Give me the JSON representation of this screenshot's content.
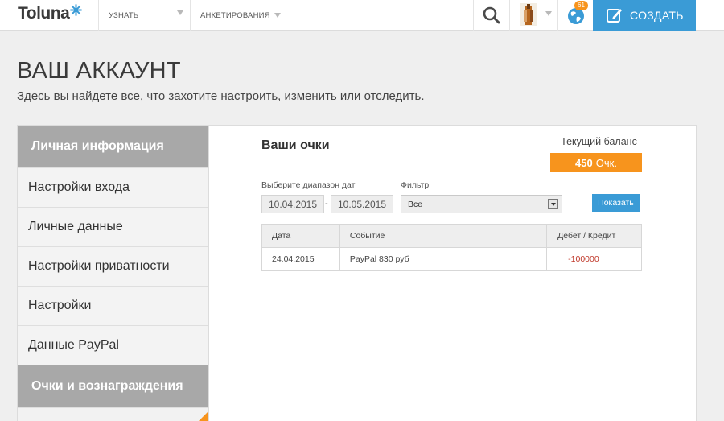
{
  "header": {
    "logo_text": "Toluna",
    "nav": [
      {
        "label": "УЗНАТЬ"
      },
      {
        "label": "АНКЕТИРОВАНИЯ"
      }
    ],
    "notifications_count": "61",
    "create_label": "СОЗДАТЬ"
  },
  "page": {
    "title": "ВАШ АККАУНТ",
    "subtitle": "Здесь вы найдете все, что захотите настроить, изменить или отследить."
  },
  "sidebar": {
    "items": [
      {
        "label": "Личная информация"
      },
      {
        "label": "Настройки входа"
      },
      {
        "label": "Личные данные"
      },
      {
        "label": "Настройки приватности"
      },
      {
        "label": "Настройки"
      },
      {
        "label": "Данные PayPal"
      },
      {
        "label": "Очки и вознаграждения"
      }
    ]
  },
  "points": {
    "title": "Ваши очки",
    "balance_label": "Текущий баланс",
    "balance_value": "450",
    "balance_unit": "Очк.",
    "range_label": "Выберите диапазон дат",
    "date_from": "10.04.2015",
    "date_to": "10.05.2015",
    "date_separator": "-",
    "filter_label": "Фильтр",
    "filter_value": "Все",
    "show_button": "Показать",
    "table": {
      "headers": [
        "Дата",
        "Событие",
        "Дебет / Кредит"
      ],
      "rows": [
        {
          "date": "24.04.2015",
          "event": "PayPal 830 руб",
          "amount": "-100000"
        }
      ]
    }
  },
  "colors": {
    "accent_blue": "#3a9bd6",
    "accent_orange": "#f7941d",
    "sidebar_active": "#a8a8a8"
  }
}
